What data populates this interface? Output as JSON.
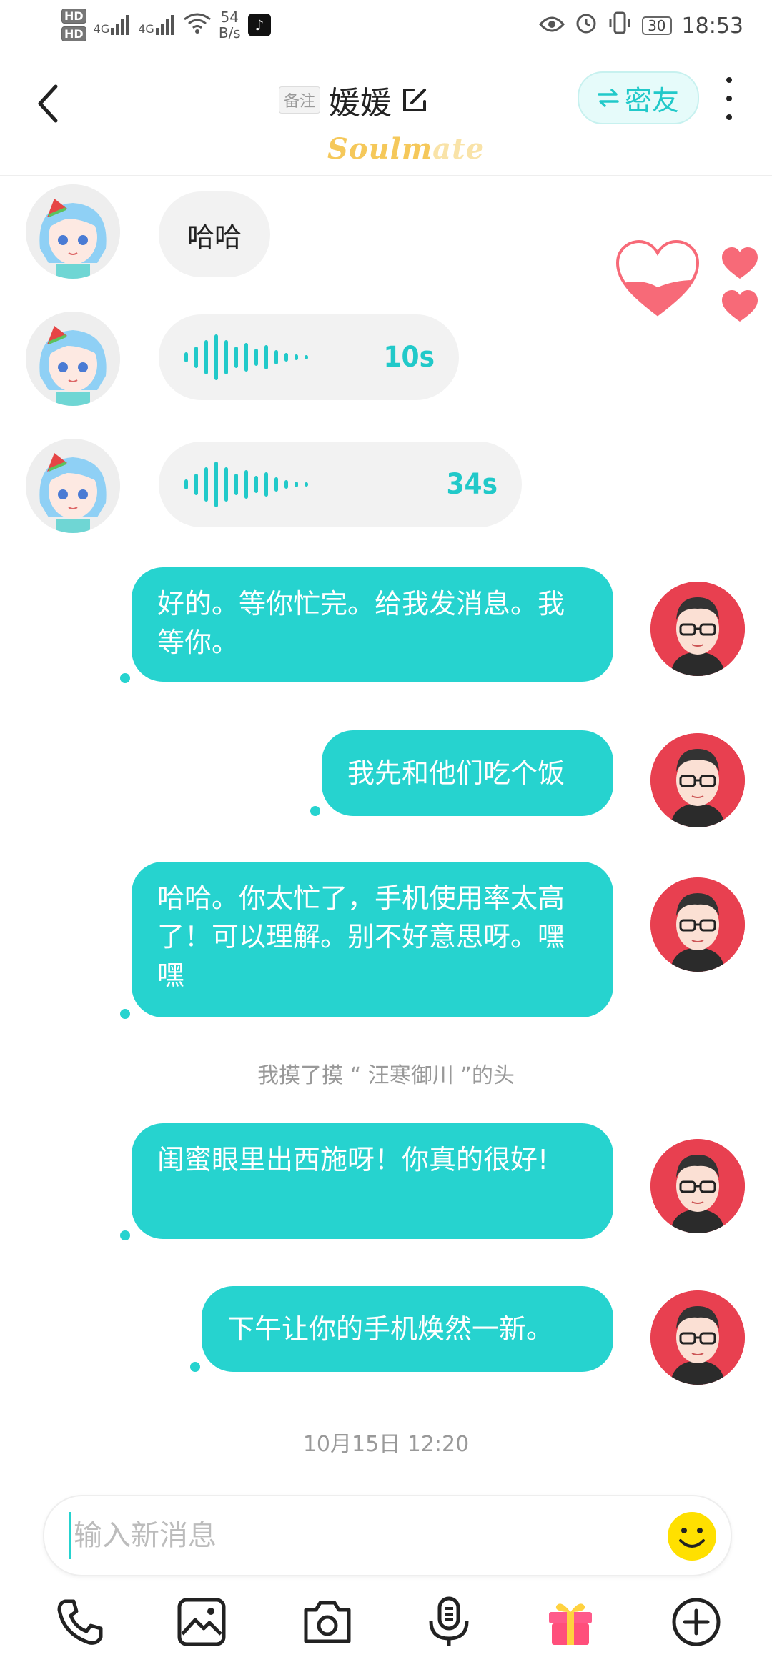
{
  "status_bar": {
    "hd1": "HD",
    "hd2": "HD",
    "sig1": "4G",
    "sig2": "4G",
    "speed_value": "54",
    "speed_unit": "B/s",
    "battery": "30",
    "time": "18:53"
  },
  "header": {
    "note_tag": "备注",
    "title": "媛媛",
    "friend_button": "密友",
    "brand": "Soulmate"
  },
  "messages": {
    "in1": "哈哈",
    "voice1": "10s",
    "voice2": "34s",
    "out1": "好的。等你忙完。给我发消息。我等你。",
    "out2": "我先和他们吃个饭",
    "out3": "哈哈。你太忙了，手机使用率太高了！可以理解。别不好意思呀。嘿嘿",
    "system": "我摸了摸 “ 汪寒御川 ”的头",
    "out4": "闺蜜眼里出西施呀！你真的很好!",
    "out5": "下午让你的手机焕然一新。",
    "timestamp": "10月15日 12:20"
  },
  "input": {
    "placeholder": "输入新消息"
  },
  "toolbar": {
    "icons": [
      "phone-icon",
      "image-icon",
      "camera-icon",
      "voice-icon",
      "gift-icon",
      "plus-icon"
    ]
  },
  "colors": {
    "accent": "#26d3cf",
    "incoming_bubble": "#f2f2f2",
    "avatar_right_bg": "#e84050",
    "brand_yellow": "#f5c85a",
    "heart": "#f76a78"
  }
}
